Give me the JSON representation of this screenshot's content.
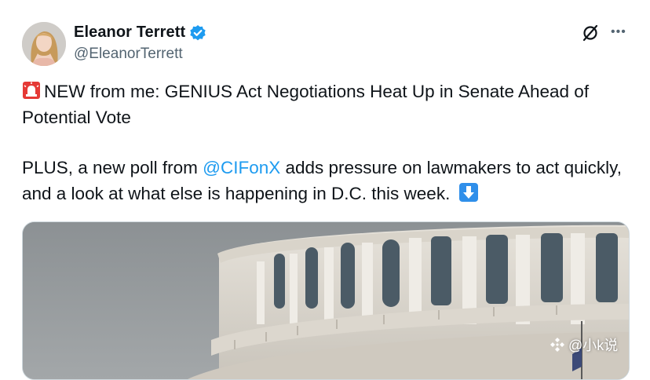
{
  "author": {
    "display_name": "Eleanor Terrett",
    "handle": "@EleanorTerrett",
    "verified_icon": "verified-badge-icon",
    "avatar_icon": "user-avatar-photo"
  },
  "header_actions": {
    "grok_icon": "slashed-circle-icon",
    "more_icon": "more-options-icon",
    "more_label": "•••"
  },
  "tweet": {
    "line1_emoji": "🚨",
    "line1_text": "NEW from me: GENIUS Act Negotiations Heat Up in Senate Ahead of Potential Vote",
    "para2_before_mention": "PLUS, a new poll from ",
    "mention": "@CIFonX",
    "para2_after_mention": " adds pressure on lawmakers to act quickly, and a look at what else is happening in D.C. this week.",
    "arrow_emoji": "⬇️"
  },
  "watermark": {
    "text": "@小k说",
    "icon": "diamond-logo-icon"
  },
  "colors": {
    "accent_blue": "#1D9BF0",
    "text_primary": "#0F1419",
    "text_secondary": "#536471",
    "siren_red": "#E53935",
    "arrow_blue": "#2F8FEA"
  }
}
